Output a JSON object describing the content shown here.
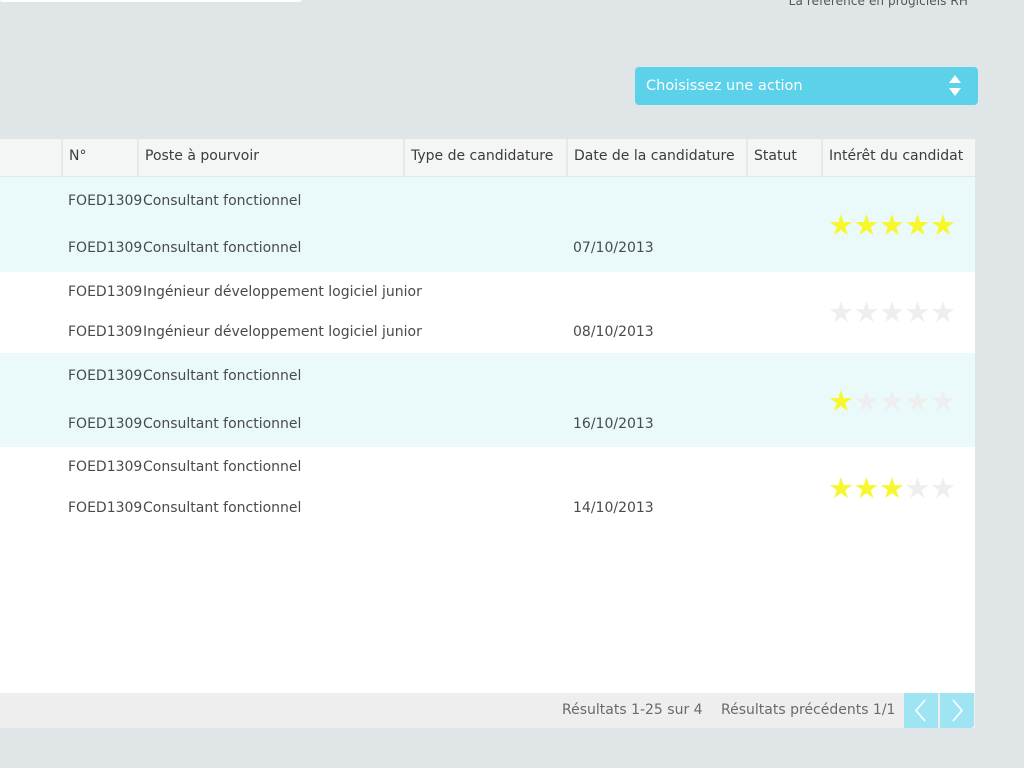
{
  "header": {
    "tagline": "La référence en progiciels RH"
  },
  "action_select": {
    "label": "Choisissez une action"
  },
  "table": {
    "columns": [
      "N°",
      "Poste à pourvoir",
      "Type de candidature",
      "Date de la candidature",
      "Statut",
      "Intérêt du candidat"
    ],
    "rows": [
      {
        "lines": [
          {
            "num": "FOED1309",
            "poste": "Consultant fonctionnel",
            "date": ""
          },
          {
            "num": "FOED1309",
            "poste": "Consultant fonctionnel",
            "date": "07/10/2013"
          }
        ],
        "rating": 5
      },
      {
        "lines": [
          {
            "num": "FOED1309",
            "poste": "Ingénieur développement logiciel junior",
            "date": ""
          },
          {
            "num": "FOED1309",
            "poste": "Ingénieur développement logiciel junior",
            "date": "08/10/2013"
          }
        ],
        "rating": 0
      },
      {
        "lines": [
          {
            "num": "FOED1309",
            "poste": "Consultant fonctionnel",
            "date": ""
          },
          {
            "num": "FOED1309",
            "poste": "Consultant fonctionnel",
            "date": "16/10/2013"
          }
        ],
        "rating": 1
      },
      {
        "lines": [
          {
            "num": "FOED1309",
            "poste": "Consultant fonctionnel",
            "date": ""
          },
          {
            "num": "FOED1309",
            "poste": "Consultant fonctionnel",
            "date": "14/10/2013"
          }
        ],
        "rating": 3
      }
    ],
    "rating_max": 5
  },
  "footer": {
    "results_label": "Résultats 1-25 sur 4",
    "previous_label": "Résultats précédents 1/1"
  },
  "colors": {
    "accent": "#5bd1ea",
    "star_on": "#f7f72f",
    "star_off": "#eeeeee",
    "row_alt": "#eafafb"
  }
}
